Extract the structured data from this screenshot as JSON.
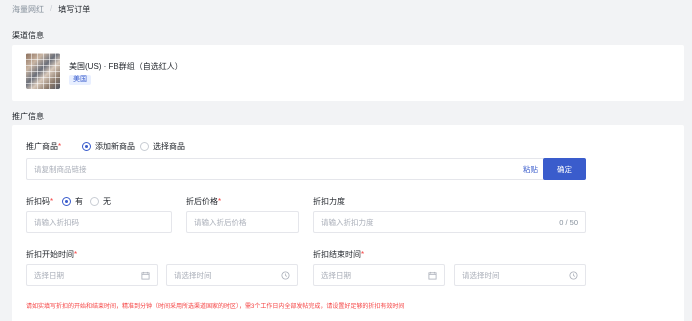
{
  "breadcrumb": {
    "parent": "海量网红",
    "separator": "/",
    "current": "填写订单"
  },
  "channel": {
    "section_title": "渠道信息",
    "name": "美国(US) · FB群组（自选红人）",
    "tag": "美国"
  },
  "promo": {
    "section_title": "推广信息",
    "product": {
      "label": "推广商品",
      "options": [
        "添加新商品",
        "选择商品"
      ],
      "selected": 0,
      "link_placeholder": "请复制商品链接",
      "paste_label": "粘贴",
      "confirm_label": "确定"
    },
    "discount_code": {
      "label": "折扣码",
      "options": [
        "有",
        "无"
      ],
      "selected": 0,
      "placeholder": "请输入折扣码"
    },
    "price_after": {
      "label": "折后价格",
      "placeholder": "请输入折后价格"
    },
    "discount_strength": {
      "label": "折扣力度",
      "placeholder": "请输入折扣力度",
      "counter": "0 / 50"
    },
    "start_time": {
      "label": "折扣开始时间",
      "date_placeholder": "选择日期",
      "time_placeholder": "请选择时间"
    },
    "end_time": {
      "label": "折扣结束时间",
      "date_placeholder": "选择日期",
      "time_placeholder": "请选择时间"
    },
    "hint": "请如实填写折扣的开始和结束时间，精准到分钟（时间采用所选渠道国家的时区），需3个工作日内全部发帖完成，请设置好足够的折扣有效时间"
  },
  "colors": {
    "accent": "#3a5ccc",
    "required": "#f53f3f",
    "background": "#f2f3f5"
  }
}
